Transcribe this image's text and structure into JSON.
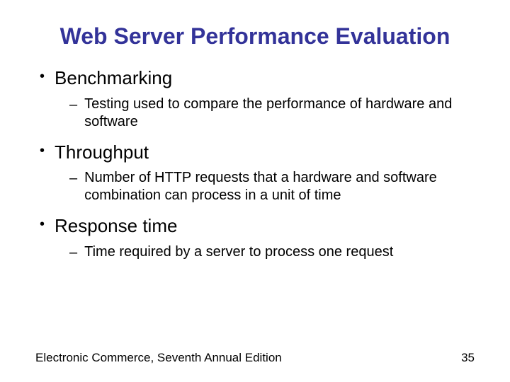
{
  "title": "Web Server Performance Evaluation",
  "bullets": [
    {
      "label": "Benchmarking",
      "sub": "Testing used to compare the performance of hardware and software"
    },
    {
      "label": "Throughput",
      "sub": "Number of HTTP requests that a hardware and software combination can process in a unit of time"
    },
    {
      "label": "Response time",
      "sub": "Time required by a server to process one request"
    }
  ],
  "footer": {
    "source": "Electronic Commerce, Seventh Annual Edition",
    "page": "35"
  }
}
